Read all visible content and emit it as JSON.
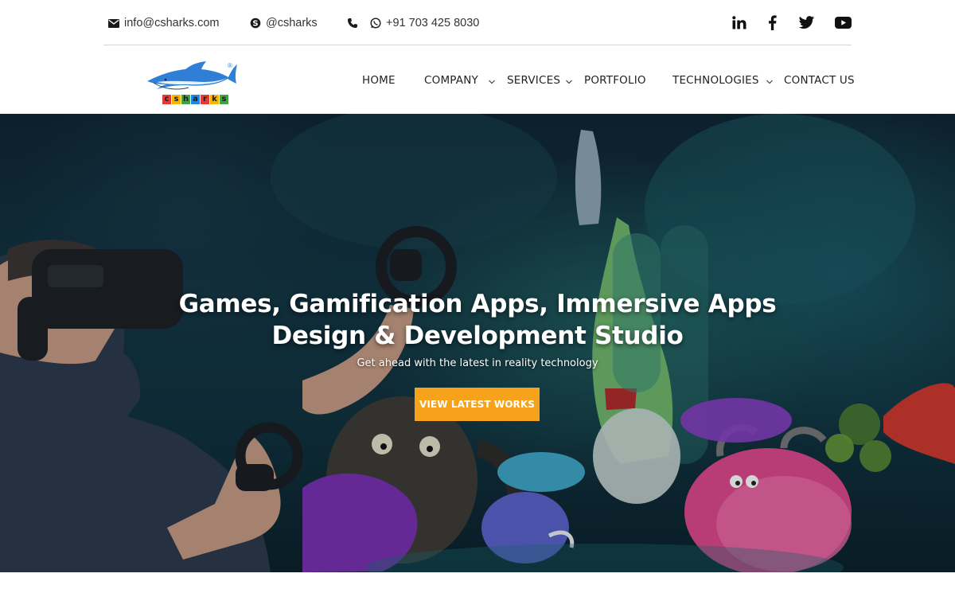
{
  "topbar": {
    "email": "info@csharks.com",
    "skype": "@csharks",
    "phone": "+91 703 425 8030",
    "icons": [
      "envelope-icon",
      "skype-icon",
      "phone-icon",
      "whatsapp-icon"
    ],
    "social": [
      "linkedin-icon",
      "facebook-icon",
      "twitter-icon",
      "youtube-icon"
    ]
  },
  "logo": {
    "letters": [
      "c",
      "s",
      "h",
      "a",
      "r",
      "k",
      "s"
    ],
    "letter_colors": [
      "#e53935",
      "#f4b400",
      "#43a047",
      "#1e88e5",
      "#e53935",
      "#f4b400",
      "#43a047"
    ],
    "registered": "®"
  },
  "nav": {
    "home": "HOME",
    "company": "COMPANY",
    "services": "SERVICES",
    "portfolio": "PORTFOLIO",
    "technologies": "TECHNOLOGIES",
    "contact": "CONTACT US"
  },
  "hero": {
    "title_line1": "Games, Gamification Apps, Immersive Apps",
    "title_line2": "Design & Development Studio",
    "subtitle": "Get ahead with the latest in reality technology",
    "cta": "VIEW LATEST WORKS"
  },
  "colors": {
    "accent": "#f7a21b",
    "logo_blue": "#2f7fd6",
    "text": "#222222"
  }
}
